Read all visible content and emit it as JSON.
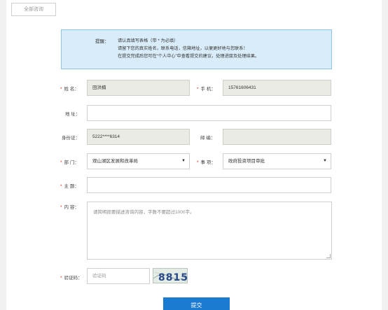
{
  "header": {
    "all_inquiries_label": "全部咨询"
  },
  "notice": {
    "label": "提醒：",
    "lines": [
      "请认真填写表格（带 * 为必填）",
      "请留下您的真实姓名，联系电话，信箱地址，以便更好地与您联系！",
      "在提交完成后您可在“个人中心”中查看提交的建议，处理进度及处理结果。"
    ]
  },
  "form": {
    "required_mark": "*",
    "name_label": "姓 名：",
    "name_value": "田洪楠",
    "phone_label": "手 机：",
    "phone_value": "15761606431",
    "address_label": "地 址：",
    "address_value": "",
    "id_label": "身份证：",
    "id_value": "5222****6314",
    "postcode_label": "邮 编：",
    "postcode_value": "",
    "dept_label": "部 门：",
    "dept_value": "观山湖区发展和改革局",
    "matter_label": "事 项：",
    "matter_value": "政府投资项目审批",
    "subject_label": "主 题：",
    "subject_value": "",
    "content_label": "内 容：",
    "content_placeholder": "请简明扼要描述咨询内容，字数不要超过1000字。",
    "captcha_label": "验证码：",
    "captcha_placeholder": "验证码",
    "captcha_image_text": "8815",
    "submit_label": "提交"
  }
}
